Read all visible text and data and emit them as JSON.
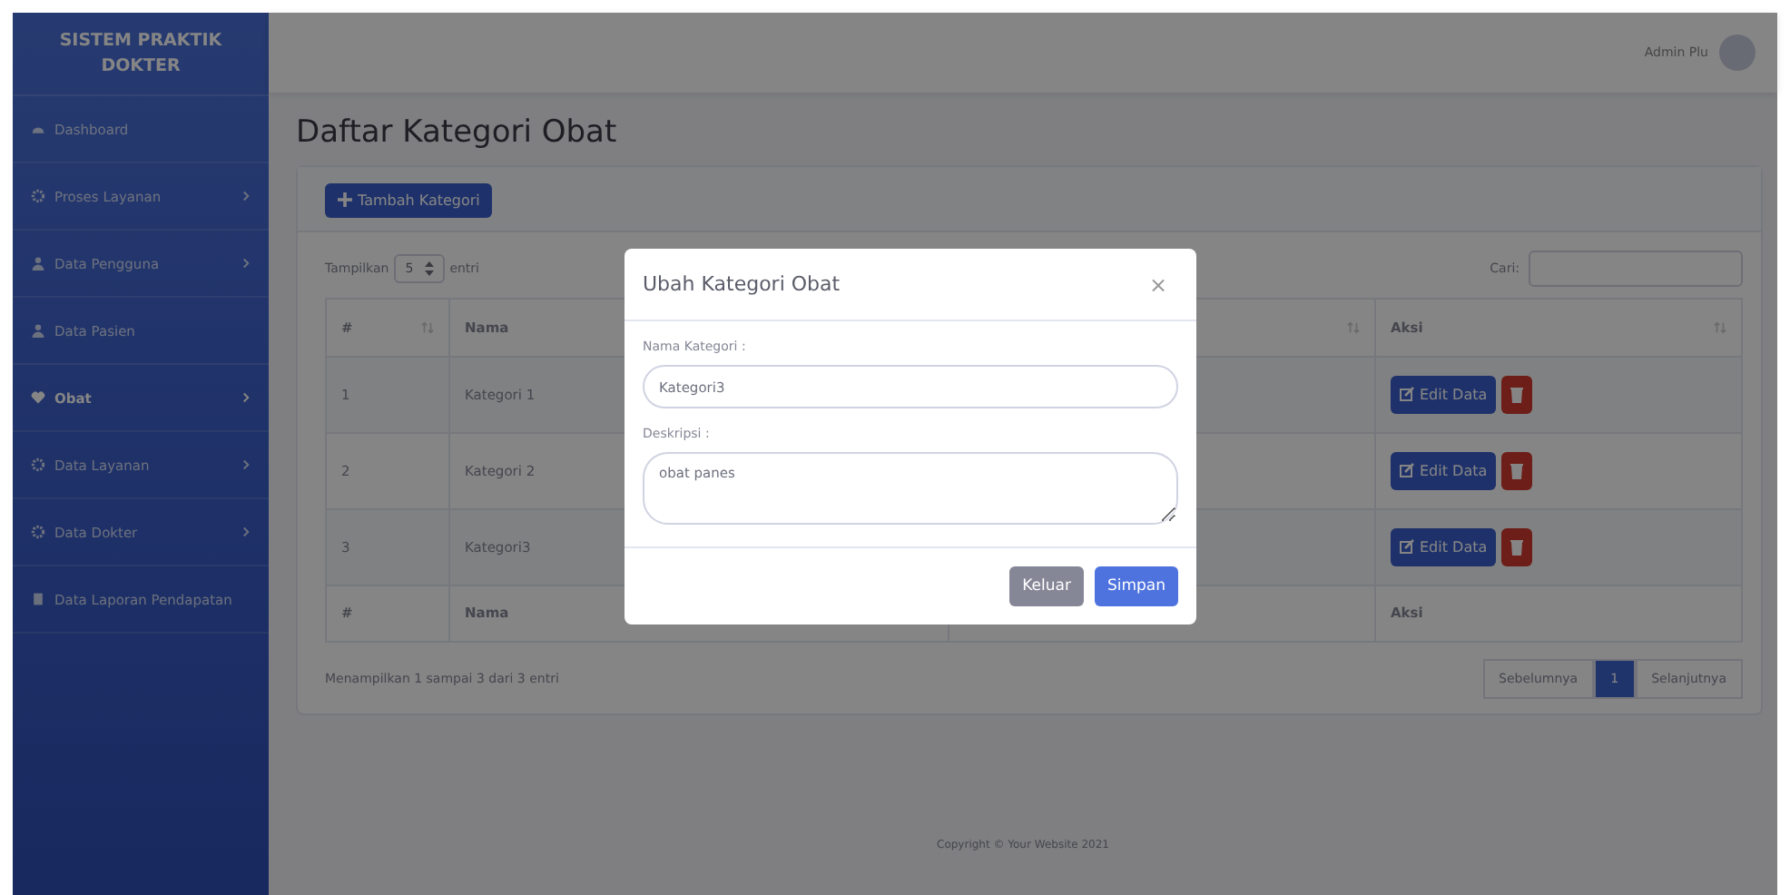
{
  "sidebar": {
    "brand": "SISTEM PRAKTIK DOKTER",
    "items": [
      {
        "label": "Dashboard",
        "has_submenu": false,
        "selected": false
      },
      {
        "label": "Proses Layanan",
        "has_submenu": true,
        "selected": false
      },
      {
        "label": "Data Pengguna",
        "has_submenu": true,
        "selected": false
      },
      {
        "label": "Data Pasien",
        "has_submenu": false,
        "selected": false
      },
      {
        "label": "Obat",
        "has_submenu": true,
        "selected": true
      },
      {
        "label": "Data Layanan",
        "has_submenu": true,
        "selected": false
      },
      {
        "label": "Data Dokter",
        "has_submenu": true,
        "selected": false
      },
      {
        "label": "Data Laporan Pendapatan",
        "has_submenu": false,
        "selected": false
      }
    ]
  },
  "topbar": {
    "user_name": "Admin Plu"
  },
  "page_title": "Daftar Kategori Obat",
  "add_button": "Tambah Kategori",
  "length_control": {
    "before": "Tampilkan",
    "value": "5",
    "after": "entri"
  },
  "search": {
    "label": "Cari:"
  },
  "table": {
    "columns": [
      "#",
      "Nama",
      "Aksi"
    ],
    "rows": [
      {
        "number": "1",
        "name": "Kategori 1",
        "edit": "Edit Data"
      },
      {
        "number": "2",
        "name": "Kategori 2",
        "edit": "Edit Data"
      },
      {
        "number": "3",
        "name": "Kategori3",
        "edit": "Edit Data"
      }
    ],
    "footer": [
      "#",
      "Nama",
      "Aksi"
    ]
  },
  "info": "Menampilkan 1 sampai 3 dari 3 entri",
  "pagination": [
    {
      "label": "Sebelumnya",
      "selected": false
    },
    {
      "label": "1",
      "selected": true
    },
    {
      "label": "Selanjutnya",
      "selected": false
    }
  ],
  "footer": "Copyright © Your Website 2021",
  "modal": {
    "title": "Ubah Kategori Obat",
    "close": "×",
    "fields": [
      {
        "label": "Nama Kategori :",
        "value": "Kategori3",
        "kind": "input"
      },
      {
        "label": "Deskripsi :",
        "value": "obat panes",
        "kind": "textarea"
      }
    ],
    "buttons": [
      {
        "label": "Keluar",
        "kind": "secondary"
      },
      {
        "label": "Simpan",
        "kind": "primary"
      }
    ]
  }
}
